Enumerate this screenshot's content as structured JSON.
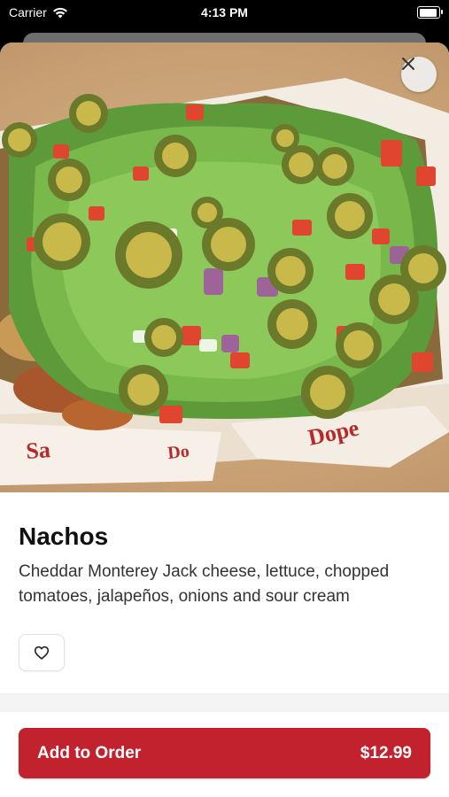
{
  "status_bar": {
    "carrier": "Carrier",
    "time": "4:13 PM"
  },
  "item": {
    "name": "Nachos",
    "description": "Cheddar Monterey Jack cheese, lettuce, chopped tomatoes, jalapeños, onions and sour cream"
  },
  "actions": {
    "add_label": "Add to Order",
    "price": "$12.99"
  },
  "colors": {
    "accent": "#c2212e",
    "background": "#ffffff"
  },
  "icons": {
    "close": "close-icon",
    "favorite": "heart-icon",
    "wifi": "wifi-icon",
    "battery": "battery-icon"
  }
}
